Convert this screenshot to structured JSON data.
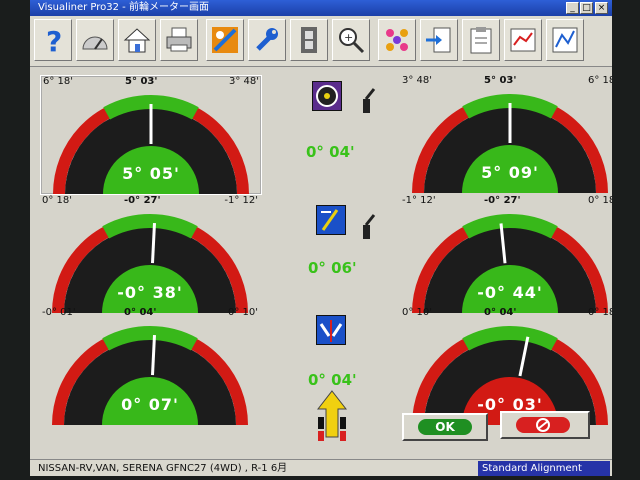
{
  "window": {
    "title": "Visualiner Pro32  -  前輪メーター画面",
    "minimize": "_",
    "maximize": "□",
    "close": "×"
  },
  "toolbar": [
    "help-icon",
    "gauge-icon",
    "home-icon",
    "printer-icon",
    "setup-icon",
    "wrench-icon",
    "film-icon",
    "zoom-icon",
    "pattern-icon",
    "export-icon",
    "clipboard-icon",
    "report-icon",
    "signal-icon"
  ],
  "gauges": [
    {
      "id": "left-camber",
      "left": "6° 18'",
      "center": "5° 03'",
      "right": "3° 48'",
      "reading": "5° 05'",
      "status": "green",
      "needle": 0.0
    },
    {
      "id": "right-camber",
      "left": "3° 48'",
      "center": "5° 03'",
      "right": "6° 18'",
      "reading": "5° 09'",
      "status": "green",
      "needle": 0.0
    },
    {
      "id": "left-caster",
      "left": "0° 18'",
      "center": "-0° 27'",
      "right": "-1° 12'",
      "reading": "-0° 38'",
      "status": "green",
      "needle": 0.05
    },
    {
      "id": "right-caster",
      "left": "-1° 12'",
      "center": "-0° 27'",
      "right": "0° 18'",
      "reading": "-0° 44'",
      "status": "green",
      "needle": -0.1
    },
    {
      "id": "left-toe",
      "left": "-0° 01'",
      "center": "0° 04'",
      "right": "0° 10'",
      "reading": "0° 07'",
      "status": "green",
      "needle": 0.05
    },
    {
      "id": "right-toe",
      "left": "0° 10'",
      "center": "0° 04'",
      "right": "0° 18'",
      "reading": "-0° 03'",
      "status": "red",
      "needle": 0.2
    }
  ],
  "cross_values": [
    "0° 04'",
    "0° 06'",
    "0° 04'"
  ],
  "buttons": {
    "ok": "OK"
  },
  "statusbar": {
    "vehicle": "NISSAN-RV,VAN, SERENA GFNC27 (4WD) , R-1 6月",
    "mode": "Standard Alignment"
  },
  "colors": {
    "green": "#38b81a",
    "red": "#d21a14",
    "track": "#1c1c1c"
  }
}
